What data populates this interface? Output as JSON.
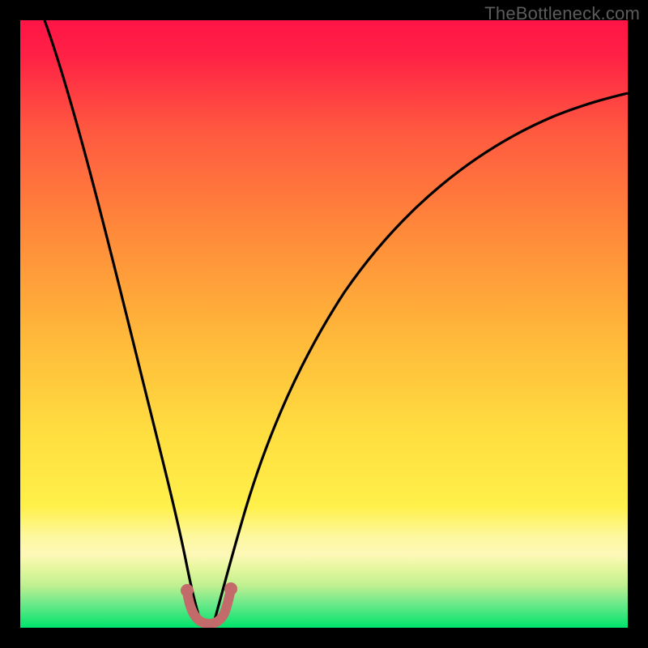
{
  "watermark": "TheBottleneck.com",
  "chart_data": {
    "type": "line",
    "title": "",
    "xlabel": "",
    "ylabel": "",
    "xlim": [
      0,
      100
    ],
    "ylim": [
      0,
      100
    ],
    "grid": false,
    "gradient_colors": {
      "top": "#ff1744",
      "mid_upper": "#ff7043",
      "mid": "#ffd54f",
      "mid_lower": "#fff176",
      "band": "#fff9b0",
      "bottom": "#00e676"
    },
    "series": [
      {
        "name": "left-branch",
        "x": [
          4,
          8,
          12,
          16,
          19,
          22,
          24,
          25.5,
          27,
          28
        ],
        "y": [
          100,
          82,
          64,
          46,
          32,
          20,
          12,
          6,
          2,
          0
        ]
      },
      {
        "name": "right-branch",
        "x": [
          30,
          31,
          32,
          34,
          37,
          41,
          46,
          52,
          60,
          70,
          82,
          100
        ],
        "y": [
          0,
          3,
          8,
          17,
          28,
          40,
          51,
          60,
          68,
          75,
          81,
          87
        ]
      }
    ],
    "valley_marker": {
      "color": "#c86b6b",
      "points_x": [
        26.5,
        27.3,
        28.5,
        30.0,
        31.0
      ],
      "points_y": [
        4.2,
        1.2,
        0.2,
        1.2,
        4.2
      ]
    }
  }
}
